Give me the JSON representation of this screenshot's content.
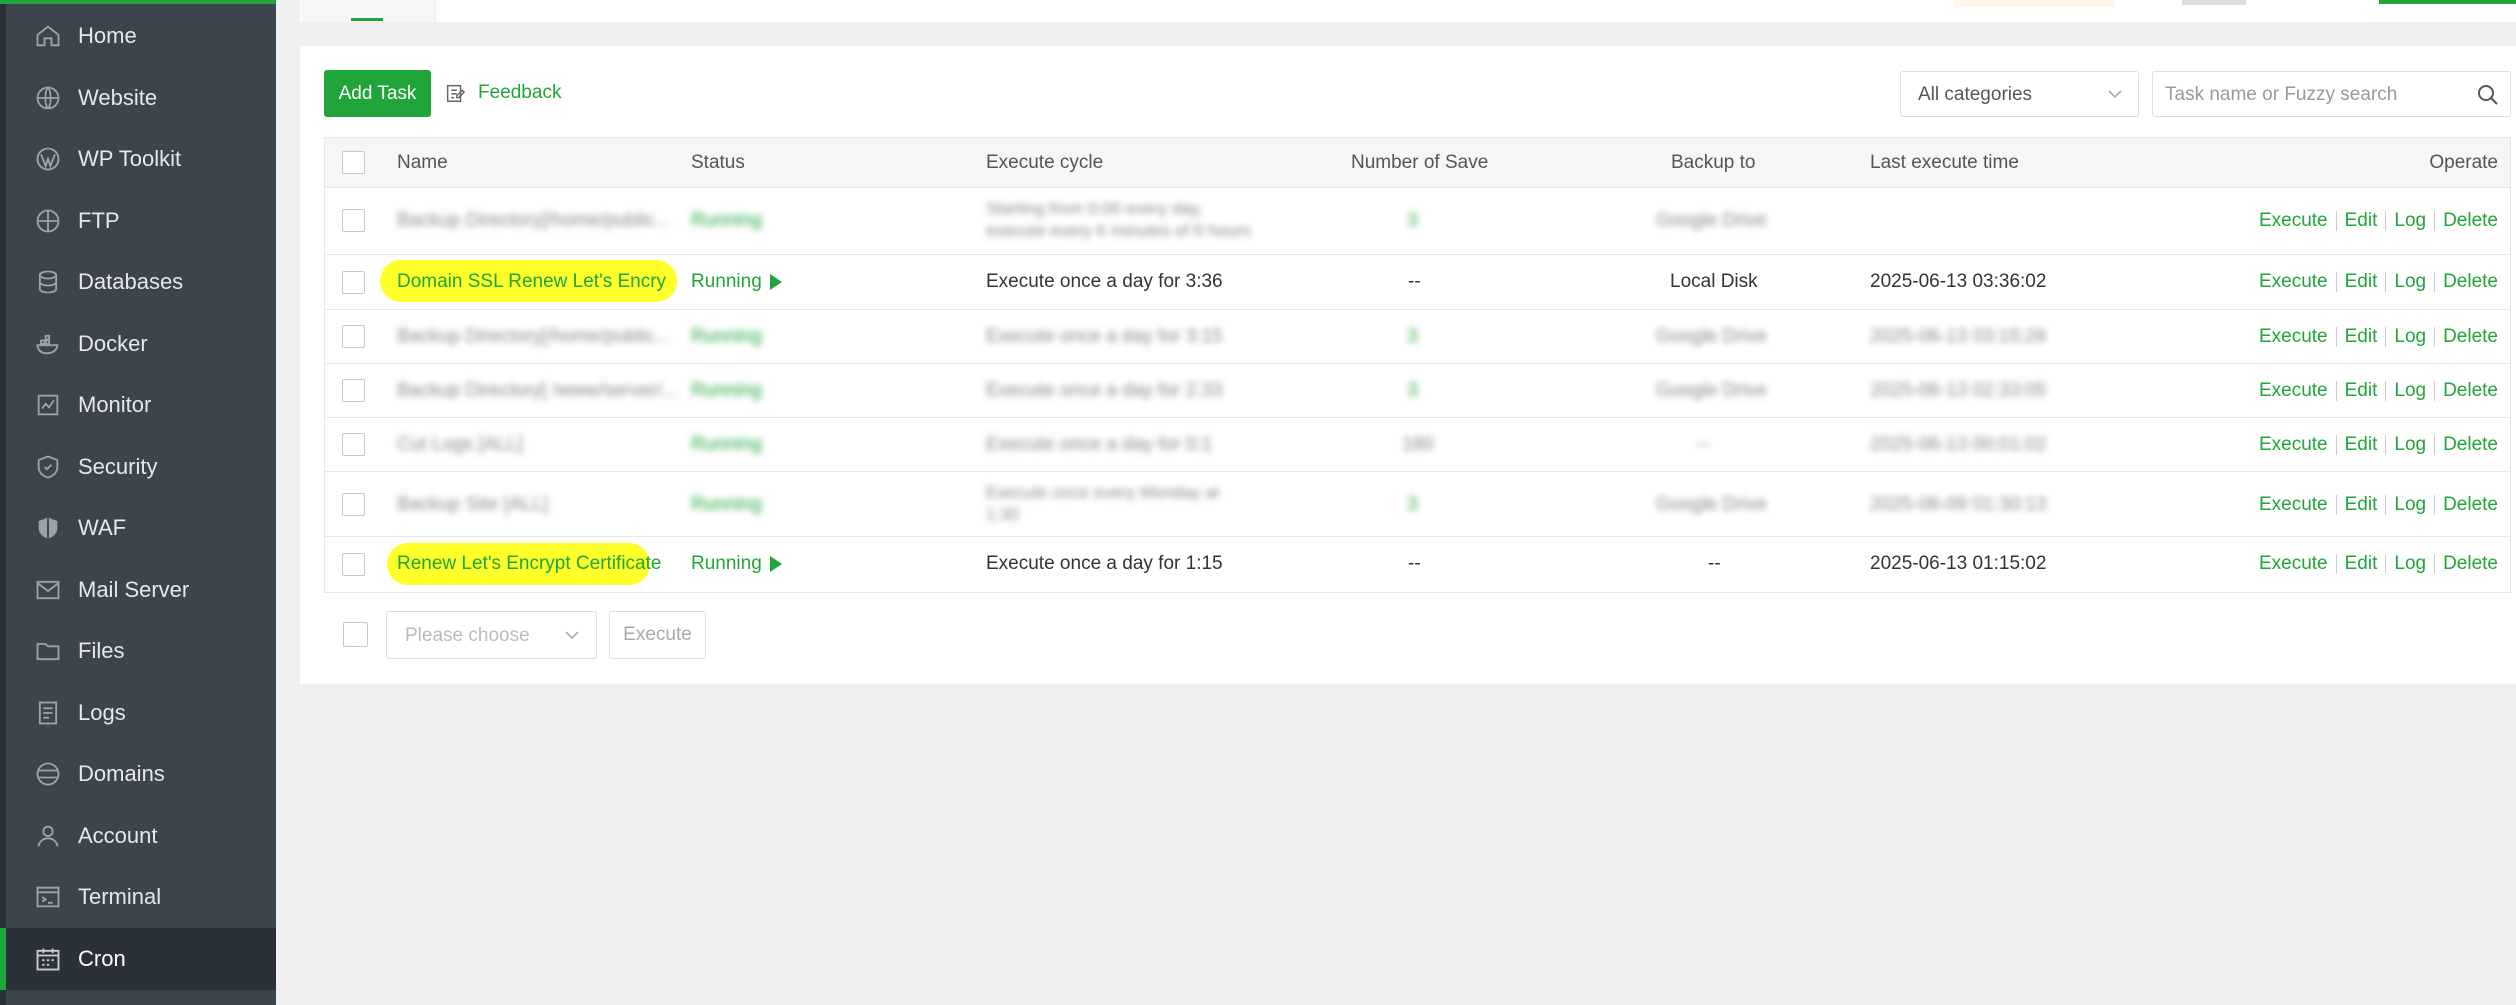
{
  "sidebar": {
    "items": [
      {
        "label": "Home",
        "icon": "home-icon"
      },
      {
        "label": "Website",
        "icon": "globe-icon"
      },
      {
        "label": "WP Toolkit",
        "icon": "wordpress-icon"
      },
      {
        "label": "FTP",
        "icon": "ftp-globe-icon"
      },
      {
        "label": "Databases",
        "icon": "database-icon"
      },
      {
        "label": "Docker",
        "icon": "docker-icon"
      },
      {
        "label": "Monitor",
        "icon": "monitor-icon"
      },
      {
        "label": "Security",
        "icon": "shield-icon"
      },
      {
        "label": "WAF",
        "icon": "waf-shield-icon"
      },
      {
        "label": "Mail Server",
        "icon": "mail-icon"
      },
      {
        "label": "Files",
        "icon": "folder-icon"
      },
      {
        "label": "Logs",
        "icon": "logs-icon"
      },
      {
        "label": "Domains",
        "icon": "domains-icon"
      },
      {
        "label": "Account",
        "icon": "user-icon"
      },
      {
        "label": "Terminal",
        "icon": "terminal-icon"
      },
      {
        "label": "Cron",
        "icon": "calendar-icon",
        "active": true
      }
    ]
  },
  "toolbar": {
    "add_task_label": "Add Task",
    "feedback_label": "Feedback",
    "category_value": "All categories",
    "search_placeholder": "Task name or Fuzzy search"
  },
  "table": {
    "headers": {
      "name": "Name",
      "status": "Status",
      "cycle": "Execute cycle",
      "saves": "Number of Save",
      "backup": "Backup to",
      "last": "Last execute time",
      "operate": "Operate"
    },
    "rows": [
      {
        "name": "Backup Directory[/home/public...",
        "status": "Running",
        "cycle": "Starting from 0:00 every day, execute every 6 minutes of 6 hours",
        "saves": "3",
        "backup": "Google Drive",
        "last": "",
        "blurred": true
      },
      {
        "name": "Domain SSL Renew Let's Encrypt...",
        "status": "Running",
        "cycle": "Execute once a day for 3:36",
        "saves": "--",
        "backup": "Local Disk",
        "last": "2025-06-13 03:36:02",
        "blurred": false
      },
      {
        "name": "Backup Directory[/home/public...",
        "status": "Running",
        "cycle": "Execute once a day for 3:15",
        "saves": "3",
        "backup": "Google Drive",
        "last": "2025-06-13 03:15:26",
        "blurred": true
      },
      {
        "name": "Backup Directory[ /www/server/...",
        "status": "Running",
        "cycle": "Execute once a day for 2:33",
        "saves": "3",
        "backup": "Google Drive",
        "last": "2025-06-13 02:33:05",
        "blurred": true
      },
      {
        "name": "Cut Logs [ALL]",
        "status": "Running",
        "cycle": "Execute once a day for 0:1",
        "saves": "180",
        "backup": "--",
        "last": "2025-06-13 00:01:02",
        "blurred": true
      },
      {
        "name": "Backup Site [ALL]",
        "status": "Running",
        "cycle": "Execute once every Monday at 1:30",
        "saves": "3",
        "backup": "Google Drive",
        "last": "2025-06-09 01:30:13",
        "blurred": true
      },
      {
        "name": "Renew Let's Encrypt Certificate",
        "status": "Running",
        "cycle": "Execute once a day for 1:15",
        "saves": "--",
        "backup": "--",
        "last": "2025-06-13 01:15:02",
        "blurred": false
      }
    ],
    "ops": {
      "execute": "Execute",
      "edit": "Edit",
      "log": "Log",
      "delete": "Delete"
    }
  },
  "batch": {
    "placeholder": "Please choose",
    "execute_label": "Execute"
  },
  "colors": {
    "accent": "#20a53a",
    "sidebar_bg": "#3c444d",
    "highlight": "#ffff2a"
  }
}
